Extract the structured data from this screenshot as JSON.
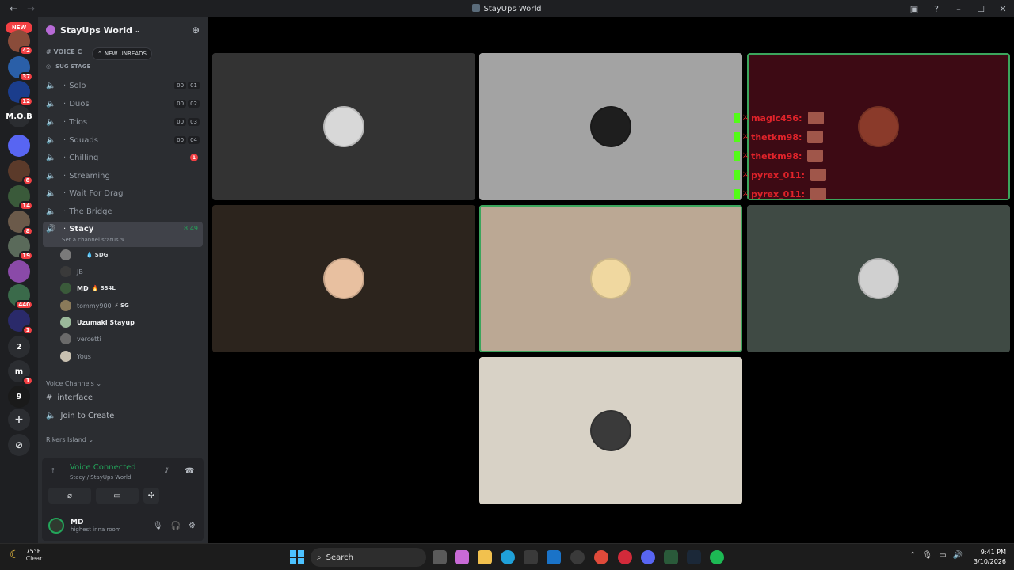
{
  "window": {
    "title": "StayUps World"
  },
  "server_rail": {
    "new_label": "NEW",
    "servers": [
      {
        "name": "server-1",
        "badge": "42",
        "color": "#8a4c3a"
      },
      {
        "name": "server-2",
        "badge": "37",
        "color": "#2a5fa8"
      },
      {
        "name": "server-3",
        "badge": "12",
        "color": "#1b3d8c"
      },
      {
        "name": "server-mob",
        "text": "M.O.B",
        "color": "#2b2d31"
      },
      {
        "name": "server-folder",
        "color": "#5865f2"
      },
      {
        "name": "server-6",
        "badge": "8",
        "color": "#5b3a2a"
      },
      {
        "name": "server-7",
        "badge": "14",
        "color": "#3a5a3a"
      },
      {
        "name": "server-8",
        "badge": "8",
        "color": "#6b5a4a"
      },
      {
        "name": "server-9",
        "badge": "19",
        "color": "#5a6a5a"
      },
      {
        "name": "server-10",
        "color": "#8a4aa8"
      },
      {
        "name": "server-11",
        "badge": "440",
        "color": "#3a6a4a"
      },
      {
        "name": "server-12",
        "badge": "1",
        "color": "#2a2a6a"
      },
      {
        "name": "server-2-text",
        "text": "2",
        "color": "#2b2d31"
      },
      {
        "name": "server-m",
        "text": "m",
        "badge": "1",
        "color": "#2b2d31"
      },
      {
        "name": "server-9-logo",
        "text": "9",
        "color": "#1a1a1a"
      }
    ]
  },
  "guild": {
    "name": "StayUps World",
    "new_unreads": "NEW UNREADS",
    "category_top": "# VOICE C",
    "stage_label": "SUG STAGE",
    "channels": [
      {
        "label": "Solo",
        "counts": [
          "00",
          "01"
        ]
      },
      {
        "label": "Duos",
        "counts": [
          "00",
          "02"
        ]
      },
      {
        "label": "Trios",
        "counts": [
          "00",
          "03"
        ]
      },
      {
        "label": "Squads",
        "counts": [
          "00",
          "04"
        ]
      },
      {
        "label": "Chilling",
        "badge": "1"
      },
      {
        "label": "Streaming"
      },
      {
        "label": "Wait For Drag"
      },
      {
        "label": "The Bridge"
      }
    ],
    "active_channel": {
      "label": "Stacy",
      "time": "8:49",
      "status": "Set a channel status"
    },
    "members": [
      {
        "name": "...",
        "tag": "SDG",
        "tag_icon": "💧",
        "av": "#7a7a7a"
      },
      {
        "name": "JB",
        "av": "#3a3a3a"
      },
      {
        "name": "MD",
        "tag": "SS4L",
        "tag_icon": "🔥",
        "bright": true,
        "av": "#3a5a3a"
      },
      {
        "name": "tommy900",
        "tag": "SG",
        "tag_icon": "⚡",
        "av": "#8a7a5a"
      },
      {
        "name": "Uzumaki Stayup",
        "bright": true,
        "av": "#9ab89a"
      },
      {
        "name": "vercetti",
        "av": "#6a6a6a"
      },
      {
        "name": "Yous",
        "av": "#c8c0b0"
      }
    ],
    "section_voice": "Voice Channels",
    "text_channel": "interface",
    "join_create": "Join to Create",
    "section_rikers": "Rikers Island"
  },
  "voice_panel": {
    "status": "Voice Connected",
    "location": "Stacy / StayUps World"
  },
  "user": {
    "name": "MD",
    "status": "highest inna room"
  },
  "video_tiles": [
    {
      "bg": "#333333",
      "av": "#d8d8d8"
    },
    {
      "bg": "#a3a3a3",
      "av": "#1e1e1e"
    },
    {
      "bg": "#3d0a14",
      "av": "#8a3a2a",
      "speaking": true
    },
    {
      "bg": "#2c241d",
      "av": "#e8c0a0"
    },
    {
      "bg": "#bba894",
      "av": "#f0d8a0",
      "speaking": true
    },
    {
      "bg": "#3f4a44",
      "av": "#d0d0d0"
    },
    {
      "bg": "#d8d2c6",
      "av": "#3a3a3a"
    }
  ],
  "chat_overlay": [
    {
      "name": "magic456:"
    },
    {
      "name": "thetkm98:"
    },
    {
      "name": "thetkm98:"
    },
    {
      "name": "pyrex_011:"
    },
    {
      "name": "pyrex_011:"
    }
  ],
  "taskbar": {
    "temp": "75°F",
    "condition": "Clear",
    "search": "Search",
    "time": "9:41 PM",
    "date": "3/10/2026"
  }
}
